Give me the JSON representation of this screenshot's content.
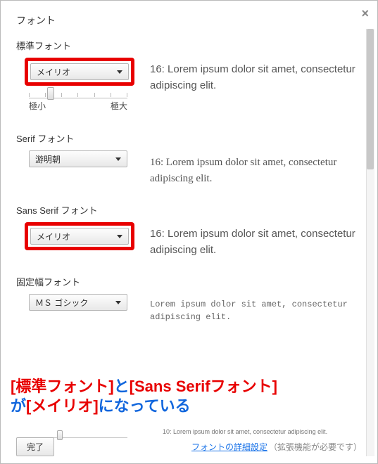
{
  "dialog": {
    "title": "フォント",
    "close": "×"
  },
  "sections": {
    "standard": {
      "label": "標準フォント",
      "selected": "メイリオ",
      "size": "16",
      "sample": "16: Lorem ipsum dolor sit amet, consectetur adipiscing elit.",
      "slider": {
        "min": "極小",
        "max": "極大"
      }
    },
    "serif": {
      "label": "Serif フォント",
      "selected": "游明朝",
      "sample": "16: Lorem ipsum dolor sit amet, consectetur adipiscing elit."
    },
    "sans": {
      "label": "Sans Serif フォント",
      "selected": "メイリオ",
      "sample": "16: Lorem ipsum dolor sit amet, consectetur adipiscing elit."
    },
    "fixed": {
      "label": "固定幅フォント",
      "selected": "ＭＳ ゴシック",
      "sample": "Lorem ipsum dolor sit amet, consectetur adipiscing elit."
    },
    "minsize": {
      "sample": "10: Lorem ipsum dolor sit amet, consectetur adipiscing elit."
    }
  },
  "footer": {
    "done": "完了",
    "link": "フォントの詳細設定",
    "note": "（拡張機能が必要です）"
  },
  "annotation": {
    "p1a": "[標準フォント]",
    "p1b": "と",
    "p1c": "[Sans Serifフォント]",
    "p2a": "が",
    "p2b": "[メイリオ]",
    "p2c": "になっている"
  }
}
